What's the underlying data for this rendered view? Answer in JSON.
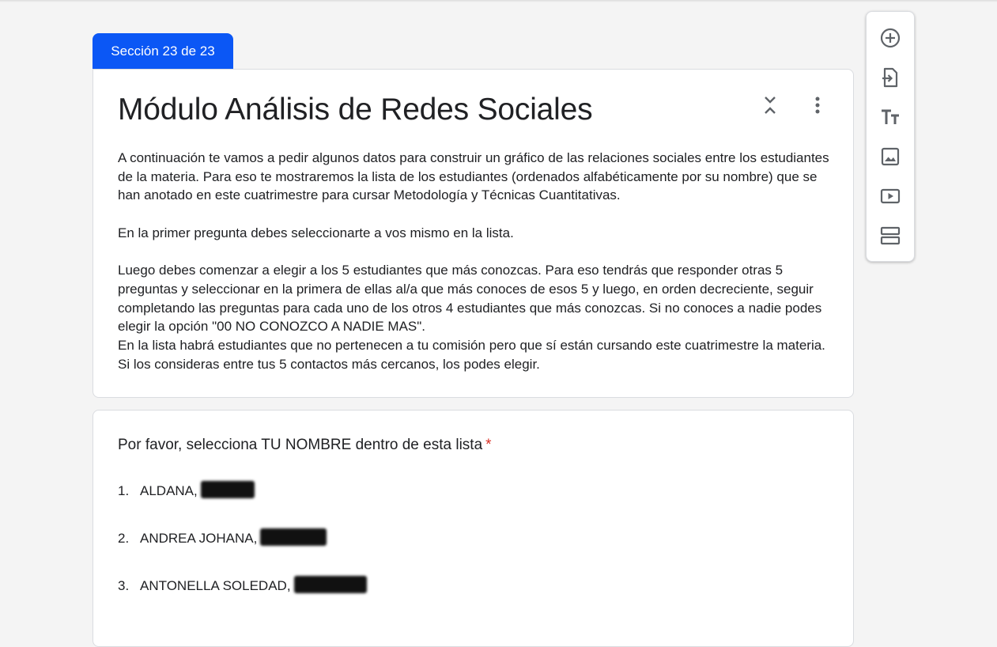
{
  "section_tab": {
    "label": "Sección 23 de 23"
  },
  "section": {
    "title": "Módulo Análisis de Redes Sociales",
    "description": [
      "A continuación te vamos a pedir algunos datos para construir un gráfico de las relaciones sociales entre los estudiantes de la materia. Para eso te mostraremos la lista de los estudiantes (ordenados alfabéticamente por su nombre) que se han anotado en este cuatrimestre para cursar Metodología y Técnicas Cuantitativas.",
      "En la primer pregunta debes seleccionarte a vos mismo en la lista.",
      "Luego debes comenzar a elegir a los 5 estudiantes que más conozcas. Para eso tendrás que responder otras 5 preguntas y seleccionar en la primera de ellas al/a que más conoces de esos 5 y luego, en orden decreciente, seguir completando las preguntas para cada uno de los otros 4 estudiantes que más conozcas. Si no conoces a nadie podes elegir la opción \"00 NO CONOZCO A NADIE MAS\".",
      "En la lista habrá estudiantes que no pertenecen a tu comisión pero que sí están cursando este cuatrimestre la materia. Si los consideras entre tus 5 contactos más cercanos, los podes elegir."
    ],
    "collapse_icon": "collapse-icon",
    "more_icon": "more-vert-icon"
  },
  "question": {
    "label": "Por favor, selecciona TU NOMBRE dentro de esta lista",
    "required_mark": "*",
    "options": [
      {
        "number": "1.",
        "text": "ALDANA,"
      },
      {
        "number": "2.",
        "text": "ANDREA JOHANA,"
      },
      {
        "number": "3.",
        "text": "ANTONELLA SOLEDAD,"
      }
    ]
  },
  "toolbar": {
    "items": [
      {
        "icon": "add-question-icon"
      },
      {
        "icon": "import-questions-icon"
      },
      {
        "icon": "add-title-icon"
      },
      {
        "icon": "add-image-icon"
      },
      {
        "icon": "add-video-icon"
      },
      {
        "icon": "add-section-icon"
      }
    ]
  },
  "colors": {
    "accent": "#0b57f5",
    "required": "#d93025",
    "background": "#f4f4f4",
    "icon": "#5f6368"
  }
}
